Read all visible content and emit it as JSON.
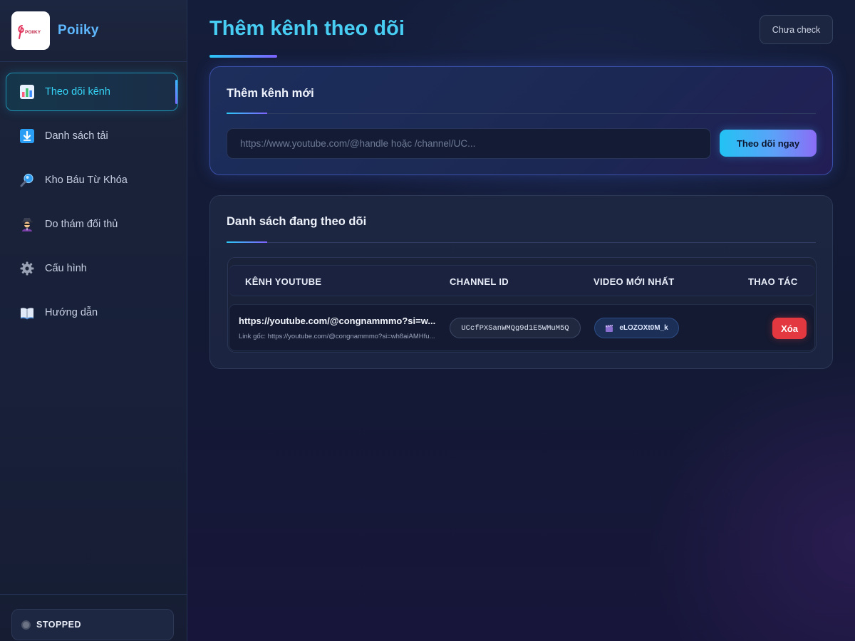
{
  "brand": {
    "name": "Poiiky",
    "logo_text": "POIIKY"
  },
  "sidebar": {
    "items": [
      {
        "label": "Theo dõi kênh",
        "icon": "bar-chart-icon",
        "active": true
      },
      {
        "label": "Danh sách tải",
        "icon": "download-icon",
        "active": false
      },
      {
        "label": "Kho Báu Từ Khóa",
        "icon": "magnifier-icon",
        "active": false
      },
      {
        "label": "Do thám đối thủ",
        "icon": "spy-icon",
        "active": false
      },
      {
        "label": "Cấu hình",
        "icon": "gear-icon",
        "active": false
      },
      {
        "label": "Hướng dẫn",
        "icon": "book-icon",
        "active": false
      }
    ],
    "status": "STOPPED"
  },
  "header": {
    "title": "Thêm kênh theo dõi",
    "check_button": "Chưa check"
  },
  "add_card": {
    "title": "Thêm kênh mới",
    "input_placeholder": "https://www.youtube.com/@handle hoặc /channel/UC...",
    "input_value": "",
    "button": "Theo dõi ngay"
  },
  "list_card": {
    "title": "Danh sách đang theo dõi",
    "columns": [
      "KÊNH YOUTUBE",
      "CHANNEL ID",
      "VIDEO MỚI NHẤT",
      "THAO TÁC"
    ],
    "rows": [
      {
        "channel_url": "https://youtube.com/@congnammmo?si=w...",
        "original_link": "Link gốc: https://youtube.com/@congnammmo?si=wh8aiAMHfu...",
        "channel_id": "UCcfPXSanWMQg9d1E5WMuM5Q",
        "latest_video": "eLOZOXt0M_k",
        "delete_label": "Xóa"
      }
    ]
  },
  "colors": {
    "accent_cyan": "#48cdf3",
    "accent_purple": "#7f62ff",
    "danger": "#e3383f",
    "background": "#131a34"
  }
}
